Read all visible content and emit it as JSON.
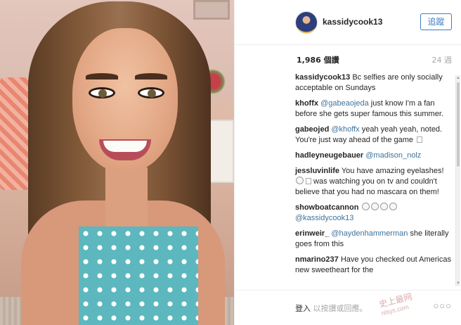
{
  "post": {
    "username": "kassidycook13",
    "follow_label": "追蹤",
    "likes": "1,986 個讚",
    "time_ago": "24 週"
  },
  "comments": [
    {
      "user": "kassidycook13",
      "text": "Bc selfies are only socially acceptable on Sundays"
    },
    {
      "user": "khoffx",
      "mention": "@gabeaojeda",
      "text": " just know I'm a fan before she gets super famous this summer."
    },
    {
      "user": "gabeojed",
      "mention": "@khoffx",
      "text": " yeah yeah yeah, noted. You're just way ahead of the game "
    },
    {
      "user": "hadleyneugebauer",
      "mention": "@madison_nolz",
      "text": ""
    },
    {
      "user": "jessluvinlife",
      "text": "You have amazing eyelashes! ",
      "text2": " was watching you on tv and couldn't believe that you had no mascara on them!"
    },
    {
      "user": "showboatcannon",
      "mention": "@kassidycook13",
      "text": ""
    },
    {
      "user": "erinweir_",
      "mention": "@haydenhammerman",
      "text": " she literally goes from this"
    },
    {
      "user": "nmarino237",
      "text": "Have you checked out Americas new sweetheart for the"
    }
  ],
  "footer": {
    "login_link": "登入",
    "login_text": " 以按讚或回應。",
    "more": "○○○"
  },
  "watermark": {
    "line1": "史上最网",
    "line2": "nlsys.com"
  }
}
